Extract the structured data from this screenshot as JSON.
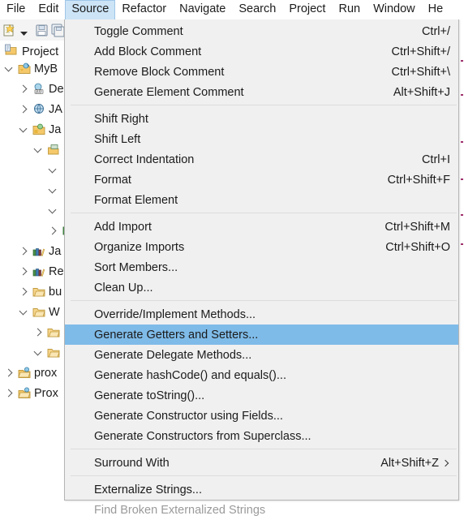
{
  "menubar": {
    "items": [
      {
        "label": "File",
        "active": false
      },
      {
        "label": "Edit",
        "active": false
      },
      {
        "label": "Source",
        "active": true
      },
      {
        "label": "Refactor",
        "active": false
      },
      {
        "label": "Navigate",
        "active": false
      },
      {
        "label": "Search",
        "active": false
      },
      {
        "label": "Project",
        "active": false
      },
      {
        "label": "Run",
        "active": false
      },
      {
        "label": "Window",
        "active": false
      },
      {
        "label": "He",
        "active": false
      }
    ]
  },
  "toolbar": {
    "icons": [
      "new-file-icon",
      "dropdown-arrow-icon",
      "save-icon",
      "save-all-icon"
    ]
  },
  "project_panel": {
    "title": "Project",
    "title_icon": "project-explorer-icon",
    "tree": [
      {
        "label": "MyB",
        "icon": "java-project-icon",
        "state": "open",
        "indent": 0
      },
      {
        "label": "De",
        "icon": "jre-library-icon",
        "state": "closed",
        "indent": 1
      },
      {
        "label": "JA",
        "icon": "jax-ws-icon",
        "state": "closed",
        "indent": 1
      },
      {
        "label": "Ja",
        "icon": "source-folder-icon",
        "state": "open",
        "indent": 1
      },
      {
        "label": "",
        "icon": "package-icon",
        "state": "open",
        "indent": 2
      },
      {
        "label": "",
        "icon": "",
        "state": "open",
        "indent": 3
      },
      {
        "label": "",
        "icon": "",
        "state": "open",
        "indent": 3
      },
      {
        "label": "",
        "icon": "",
        "state": "open",
        "indent": 3
      },
      {
        "label": "",
        "icon": "class-icon",
        "state": "closed",
        "indent": 3
      },
      {
        "label": "Ja",
        "icon": "library-icon",
        "state": "closed",
        "indent": 1
      },
      {
        "label": "Re",
        "icon": "library-icon",
        "state": "closed",
        "indent": 1
      },
      {
        "label": "bu",
        "icon": "folder-icon",
        "state": "closed",
        "indent": 1
      },
      {
        "label": "W",
        "icon": "folder-icon",
        "state": "open",
        "indent": 1
      },
      {
        "label": "",
        "icon": "folder-icon",
        "state": "closed",
        "indent": 2
      },
      {
        "label": "",
        "icon": "folder-icon",
        "state": "open",
        "indent": 2
      },
      {
        "label": "prox",
        "icon": "project-icon",
        "state": "closed",
        "indent": 0
      },
      {
        "label": "Prox",
        "icon": "project-icon",
        "state": "closed",
        "indent": 0
      }
    ]
  },
  "source_menu": {
    "name": "Source",
    "selected_item": "Generate Getters and Setters...",
    "highlight_color": "#7fbbe8",
    "background_color": "#f0f0f0",
    "groups": [
      {
        "items": [
          {
            "label": "Toggle Comment",
            "accel": "Ctrl+/",
            "submenu": false,
            "disabled": false
          },
          {
            "label": "Add Block Comment",
            "accel": "Ctrl+Shift+/",
            "submenu": false,
            "disabled": false
          },
          {
            "label": "Remove Block Comment",
            "accel": "Ctrl+Shift+\\",
            "submenu": false,
            "disabled": false
          },
          {
            "label": "Generate Element Comment",
            "accel": "Alt+Shift+J",
            "submenu": false,
            "disabled": false
          }
        ]
      },
      {
        "items": [
          {
            "label": "Shift Right",
            "accel": "",
            "submenu": false,
            "disabled": false
          },
          {
            "label": "Shift Left",
            "accel": "",
            "submenu": false,
            "disabled": false
          },
          {
            "label": "Correct Indentation",
            "accel": "Ctrl+I",
            "submenu": false,
            "disabled": false
          },
          {
            "label": "Format",
            "accel": "Ctrl+Shift+F",
            "submenu": false,
            "disabled": false
          },
          {
            "label": "Format Element",
            "accel": "",
            "submenu": false,
            "disabled": false
          }
        ]
      },
      {
        "items": [
          {
            "label": "Add Import",
            "accel": "Ctrl+Shift+M",
            "submenu": false,
            "disabled": false
          },
          {
            "label": "Organize Imports",
            "accel": "Ctrl+Shift+O",
            "submenu": false,
            "disabled": false
          },
          {
            "label": "Sort Members...",
            "accel": "",
            "submenu": false,
            "disabled": false
          },
          {
            "label": "Clean Up...",
            "accel": "",
            "submenu": false,
            "disabled": false
          }
        ]
      },
      {
        "items": [
          {
            "label": "Override/Implement Methods...",
            "accel": "",
            "submenu": false,
            "disabled": false
          },
          {
            "label": "Generate Getters and Setters...",
            "accel": "",
            "submenu": false,
            "disabled": false,
            "selected": true
          },
          {
            "label": "Generate Delegate Methods...",
            "accel": "",
            "submenu": false,
            "disabled": false
          },
          {
            "label": "Generate hashCode() and equals()...",
            "accel": "",
            "submenu": false,
            "disabled": false
          },
          {
            "label": "Generate toString()...",
            "accel": "",
            "submenu": false,
            "disabled": false
          },
          {
            "label": "Generate Constructor using Fields...",
            "accel": "",
            "submenu": false,
            "disabled": false
          },
          {
            "label": "Generate Constructors from Superclass...",
            "accel": "",
            "submenu": false,
            "disabled": false
          }
        ]
      },
      {
        "items": [
          {
            "label": "Surround With",
            "accel": "Alt+Shift+Z",
            "submenu": true,
            "disabled": false
          }
        ]
      },
      {
        "items": [
          {
            "label": "Externalize Strings...",
            "accel": "",
            "submenu": false,
            "disabled": false
          },
          {
            "label": "Find Broken Externalized Strings",
            "accel": "",
            "submenu": false,
            "disabled": true
          }
        ]
      }
    ]
  }
}
